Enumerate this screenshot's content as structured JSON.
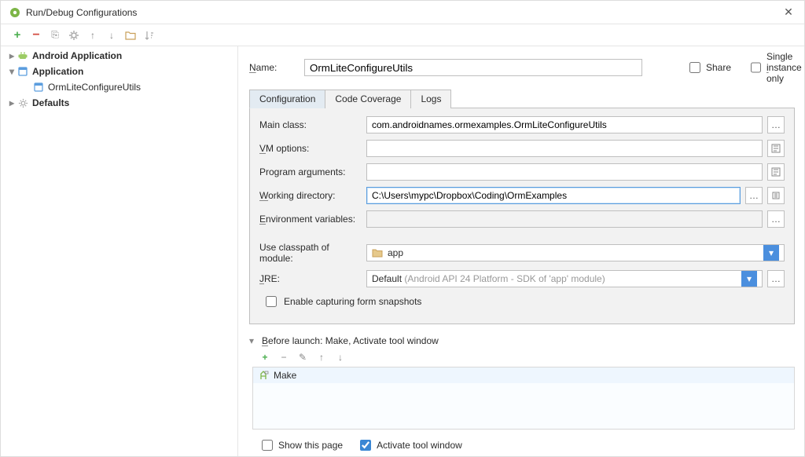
{
  "window": {
    "title": "Run/Debug Configurations"
  },
  "toolbar": {
    "add": "+",
    "remove": "−",
    "copy": "⎘",
    "edit": "⚙",
    "up": "↑",
    "down": "↓",
    "folder": "📂",
    "sort": "↕"
  },
  "tree": {
    "android": "Android Application",
    "application": "Application",
    "child": "OrmLiteConfigureUtils",
    "defaults": "Defaults"
  },
  "name": {
    "label": "Name:",
    "value": "OrmLiteConfigureUtils"
  },
  "share": "Share",
  "singleInstance": "Single instance only",
  "tabs": {
    "config": "Configuration",
    "coverage": "Code Coverage",
    "logs": "Logs"
  },
  "form": {
    "mainClassLabel": "Main class:",
    "mainClassValue": "com.androidnames.ormexamples.OrmLiteConfigureUtils",
    "vmOptionsLabel": "VM options:",
    "programArgsLabel": "Program arguments:",
    "programArgsPreU": "Program ar",
    "programArgsU": "g",
    "programArgsPost": "uments:",
    "workingDirLabel": "Working directory:",
    "workingDirValue": "C:\\Users\\mypc\\Dropbox\\Coding\\OrmExamples",
    "envVarsLabel": "Environment variables:",
    "classpathLabel": "Use classpath of module:",
    "classpathValue": "app",
    "jreLabel": "JRE:",
    "jreDefault": "Default ",
    "jreHint": "(Android API 24 Platform - SDK of 'app' module)",
    "enableSnapshots": "Enable capturing form snapshots",
    "underV": "V",
    "underW": "W",
    "underE": "E",
    "underJ": "J",
    "underN": "N",
    "underB": "B",
    "underI": "i"
  },
  "before": {
    "header": "efore launch: Make, Activate tool window",
    "add": "+",
    "remove": "−",
    "edit": "✎",
    "up": "↑",
    "down": "↓",
    "item": "Make"
  },
  "bottom": {
    "showPage": "Show this page",
    "activate": "Activate tool window"
  }
}
